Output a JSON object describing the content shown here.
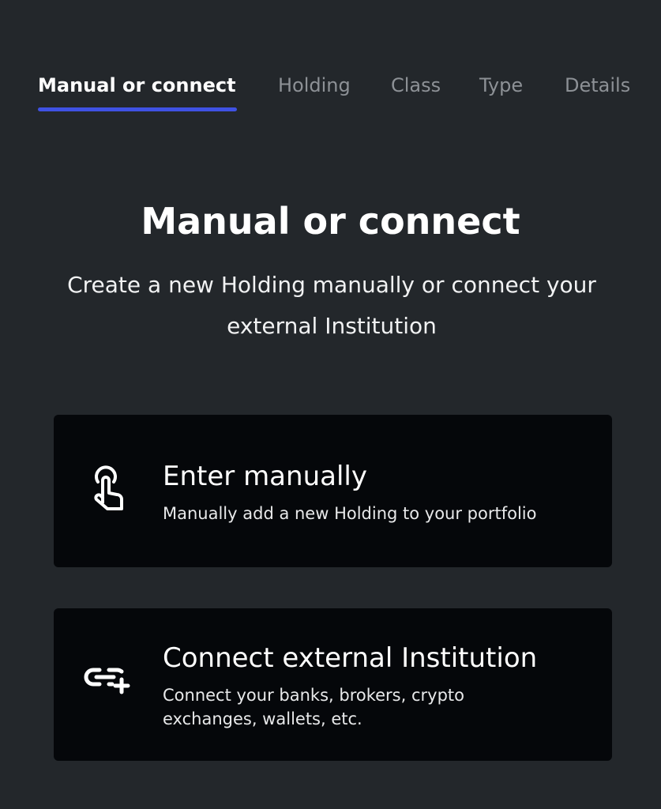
{
  "tabs": [
    {
      "label": "Manual or connect",
      "active": true
    },
    {
      "label": "Holding",
      "active": false
    },
    {
      "label": "Class",
      "active": false
    },
    {
      "label": "Type",
      "active": false
    },
    {
      "label": "Details",
      "active": false
    }
  ],
  "page": {
    "title": "Manual or connect",
    "subtitle": "Create a new Holding manually or connect your external Institution"
  },
  "options": [
    {
      "title": "Enter manually",
      "description": "Manually add a new Holding to your portfolio",
      "icon": "tap-hand-icon"
    },
    {
      "title": "Connect external Institution",
      "description": "Connect your banks, brokers, crypto exchanges, wallets, etc.",
      "icon": "link-add-icon"
    }
  ],
  "colors": {
    "background": "#23272b",
    "card": "#05070a",
    "accent": "#3f52e3",
    "inactive_tab": "#8d9196"
  }
}
